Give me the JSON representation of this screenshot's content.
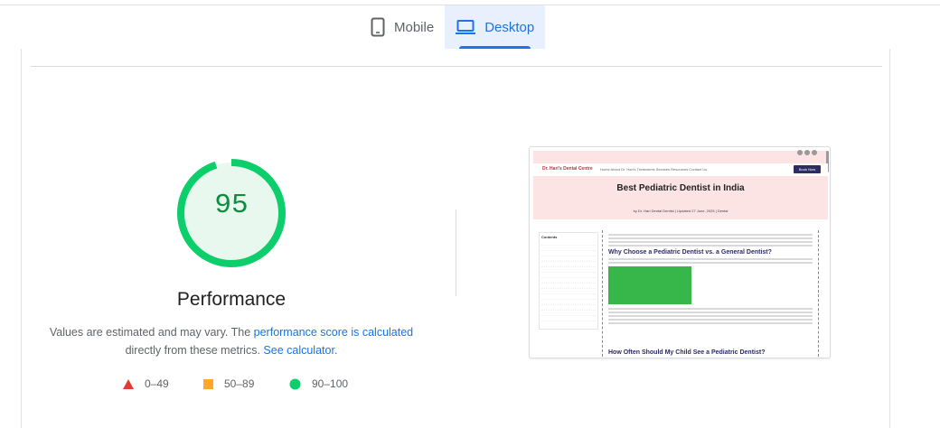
{
  "tabs": {
    "mobile_label": "Mobile",
    "desktop_label": "Desktop",
    "active": "Desktop"
  },
  "performance": {
    "score": "95",
    "score_fraction": 0.95,
    "title": "Performance",
    "note_prefix": "Values are estimated and may vary. The ",
    "note_link1": "performance score is calculated",
    "note_mid": " directly from these metrics. ",
    "note_link2": "See calculator",
    "note_suffix": "."
  },
  "legend": [
    {
      "label": "0–49",
      "shape": "triangle",
      "color": "#e53935"
    },
    {
      "label": "50–89",
      "shape": "square",
      "color": "#ffa726"
    },
    {
      "label": "90–100",
      "shape": "circle",
      "color": "#0cce6b"
    }
  ],
  "colors": {
    "good": "#0cce6b",
    "good_text": "#0a8f3f",
    "good_bg": "#e8f8ee",
    "accent": "#1a73e8"
  },
  "screenshot": {
    "hero_title": "Best Pediatric Dentist in India",
    "h2_1": "Why Choose a Pediatric Dentist vs. a General Dentist?",
    "h2_2": "How Often Should My Child See a Pediatric Dentist?",
    "toc_title": "Contents",
    "book_label": "Book Now",
    "logo": "Dr. Hari's Dental Centre",
    "navlinks": "Home   About Dr. Hari's   Treatments   Services   Resources   Contact Us",
    "byline": "by Dr. Hari Dental Dentist  |  Updated 27 June, 2025  |  Dental"
  }
}
